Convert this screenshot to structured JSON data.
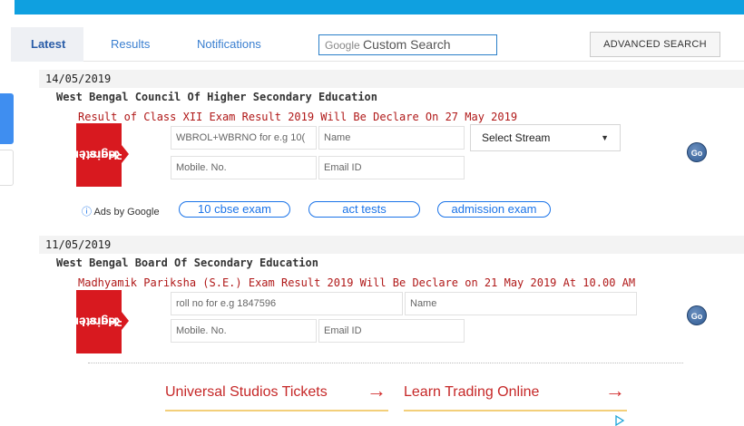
{
  "tabs": [
    {
      "label": "Latest",
      "active": true
    },
    {
      "label": "Results",
      "active": false
    },
    {
      "label": "Notifications",
      "active": false
    }
  ],
  "search": {
    "google": "Google",
    "custom": "Custom Search"
  },
  "advanced_search_label": "ADVANCED SEARCH",
  "ribbon_text": [
    "Register",
    "Here !"
  ],
  "go_label": "Go",
  "entries": [
    {
      "date": "14/05/2019",
      "org": "West Bengal Council Of Higher Secondary Education",
      "headline": "Result of Class XII Exam Result 2019 Will Be Declare On 27 May 2019",
      "roll_placeholder": "WBROL+WBRNO for e.g 10(",
      "name_placeholder": "Name",
      "mobile_placeholder": "Mobile. No.",
      "email_placeholder": "Email ID",
      "stream_select": "Select Stream"
    },
    {
      "date": "11/05/2019",
      "org": "West Bengal Board Of Secondary Education",
      "headline": "Madhyamik Pariksha (S.E.) Exam Result 2019 Will Be Declare on 21 May 2019 At 10.00 AM",
      "roll_placeholder": "roll no for e.g 1847596",
      "name_placeholder": "Name",
      "mobile_placeholder": "Mobile. No.",
      "email_placeholder": "Email ID"
    }
  ],
  "ads": {
    "label": "Ads by Google",
    "info_icon": "info-icon",
    "pills": [
      "10 cbse exam",
      "act tests",
      "admission exam"
    ],
    "links": [
      "Universal Studios Tickets",
      "Learn Trading Online"
    ]
  },
  "colors": {
    "topbar": "#0fa0e0",
    "headline": "#b01818",
    "ribbon": "#d8191f",
    "tab_link": "#3a7fd0",
    "ad_link": "#c62828",
    "pill_border": "#1a73e8"
  }
}
